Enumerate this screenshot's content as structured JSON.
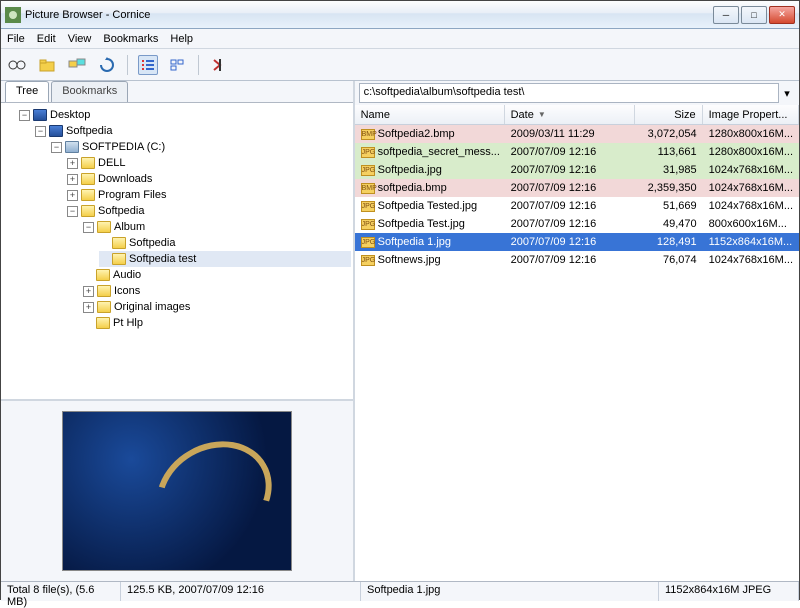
{
  "window": {
    "title": "Picture Browser - Cornice"
  },
  "menu": {
    "file": "File",
    "edit": "Edit",
    "view": "View",
    "bookmarks": "Bookmarks",
    "help": "Help"
  },
  "tabs": {
    "tree": "Tree",
    "bookmarks": "Bookmarks"
  },
  "tree": {
    "desktop": "Desktop",
    "softpedia": "Softpedia",
    "drive": "SOFTPEDIA (C:)",
    "dell": "DELL",
    "downloads": "Downloads",
    "program_files": "Program Files",
    "softpedia_folder": "Softpedia",
    "album": "Album",
    "album_softpedia": "Softpedia",
    "album_softpedia_test": "Softpedia test",
    "audio": "Audio",
    "icons": "Icons",
    "original_images": "Original images",
    "pt_hlp": "Pt Hlp"
  },
  "path": "c:\\softpedia\\album\\softpedia test\\",
  "columns": {
    "name": "Name",
    "date": "Date",
    "size": "Size",
    "props": "Image Propert..."
  },
  "files": [
    {
      "name": "Softpedia2.bmp",
      "date": "2009/03/11 11:29",
      "size": "3,072,054",
      "props": "1280x800x16M...",
      "hl": "pink",
      "type": "bmp"
    },
    {
      "name": "softpedia_secret_mess...",
      "date": "2007/07/09 12:16",
      "size": "113,661",
      "props": "1280x800x16M...",
      "hl": "green",
      "type": "jpg"
    },
    {
      "name": "Softpedia.jpg",
      "date": "2007/07/09 12:16",
      "size": "31,985",
      "props": "1024x768x16M...",
      "hl": "green",
      "type": "jpg"
    },
    {
      "name": "softpedia.bmp",
      "date": "2007/07/09 12:16",
      "size": "2,359,350",
      "props": "1024x768x16M...",
      "hl": "pink",
      "type": "bmp"
    },
    {
      "name": "Softpedia Tested.jpg",
      "date": "2007/07/09 12:16",
      "size": "51,669",
      "props": "1024x768x16M...",
      "hl": "",
      "type": "jpg"
    },
    {
      "name": "Softpedia Test.jpg",
      "date": "2007/07/09 12:16",
      "size": "49,470",
      "props": "800x600x16M...",
      "hl": "",
      "type": "jpg"
    },
    {
      "name": "Softpedia 1.jpg",
      "date": "2007/07/09 12:16",
      "size": "128,491",
      "props": "1152x864x16M...",
      "hl": "sel",
      "type": "jpg"
    },
    {
      "name": "Softnews.jpg",
      "date": "2007/07/09 12:16",
      "size": "76,074",
      "props": "1024x768x16M...",
      "hl": "",
      "type": "jpg"
    }
  ],
  "status": {
    "total": "Total 8 file(s), (5.6 MB)",
    "current_meta": "125.5 KB, 2007/07/09 12:16",
    "current_name": "Softpedia 1.jpg",
    "current_dims": "1152x864x16M JPEG"
  }
}
